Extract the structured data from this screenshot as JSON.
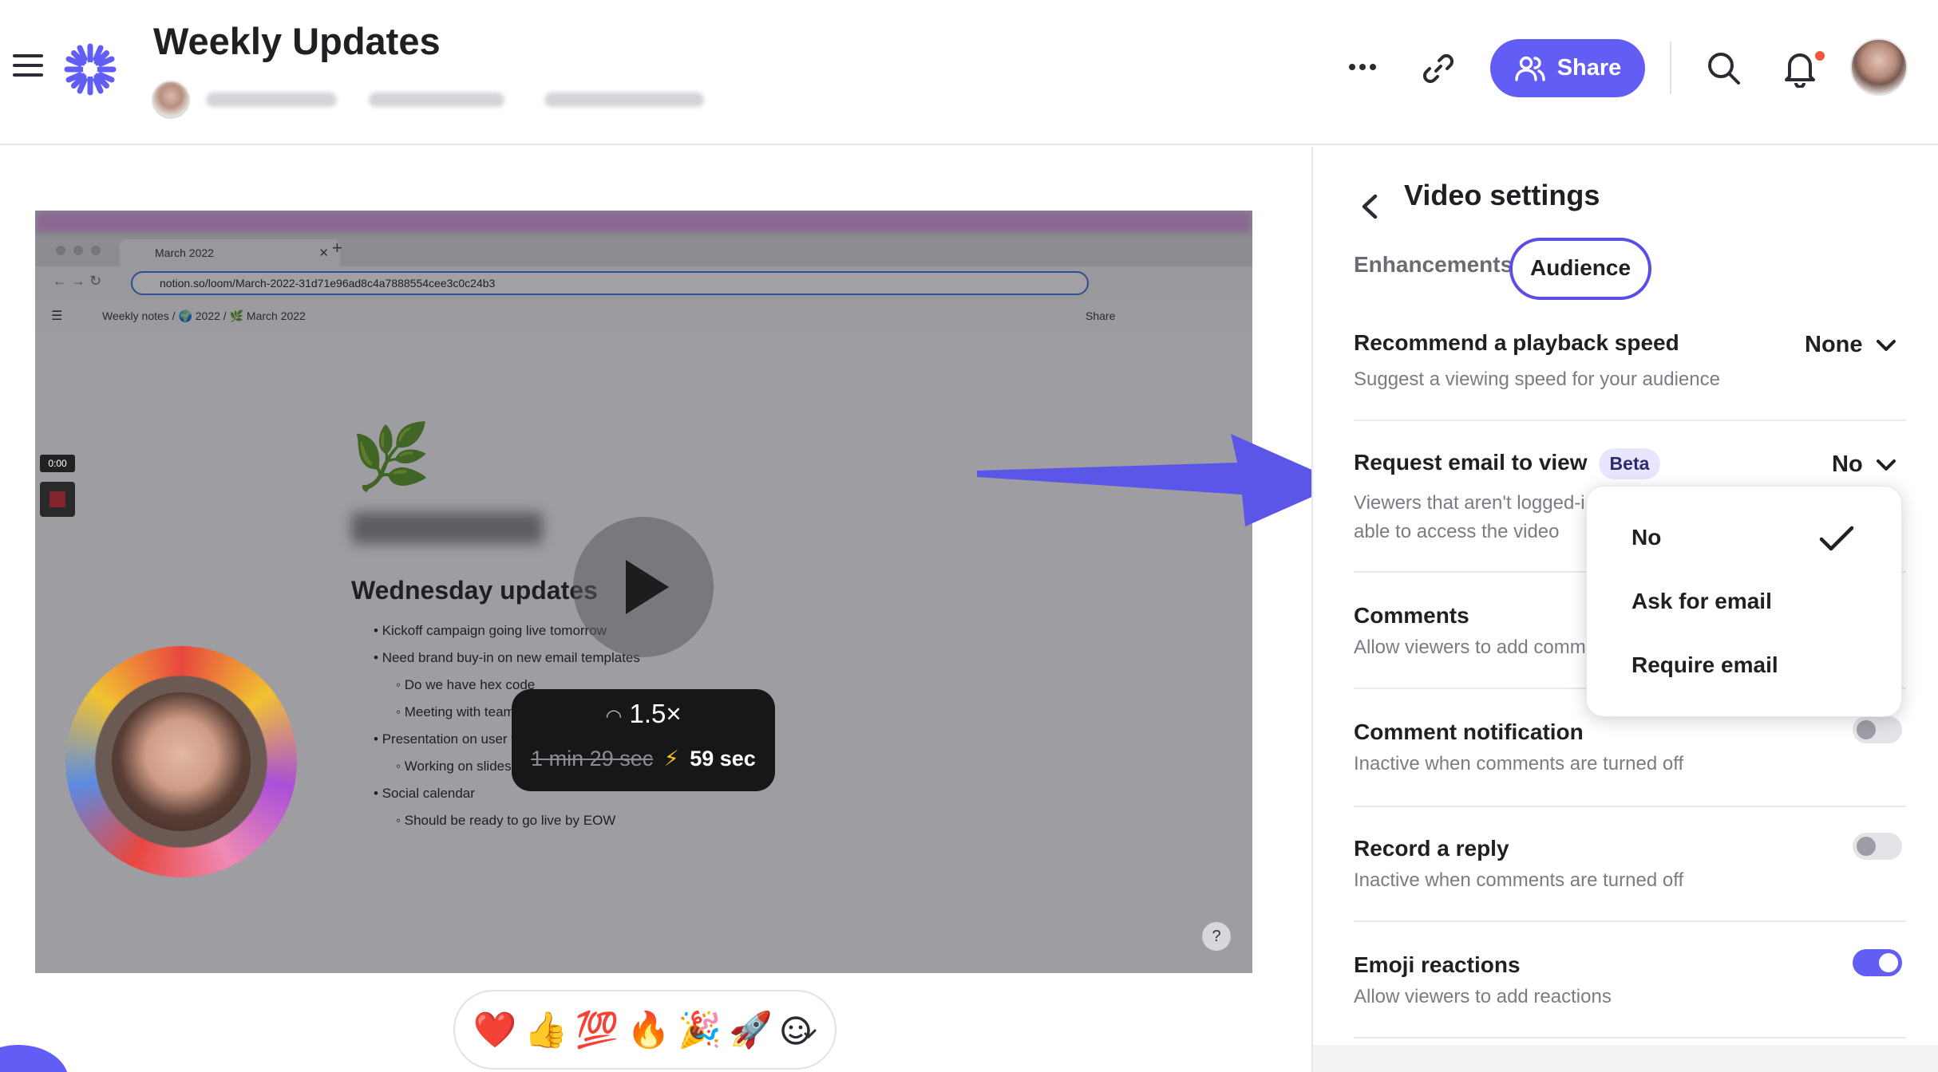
{
  "header": {
    "title": "Weekly Updates",
    "share_label": "Share"
  },
  "video": {
    "tab_title": "March 2022",
    "url": "notion.so/loom/March-2022-31d71e96ad8c4a7888554cee3c0c24b3",
    "breadcrumb": "Weekly notes  /  🌍 2022  /  🌿 March 2022",
    "notion_share": "Share",
    "timestamp": "0:00",
    "section_heading": "Wednesday updates",
    "bullets": [
      {
        "level": 1,
        "text": "Kickoff campaign going live tomorrow"
      },
      {
        "level": 1,
        "text": "Need brand buy-in on new email templates"
      },
      {
        "level": 2,
        "text": "Do we have hex code"
      },
      {
        "level": 2,
        "text": "Meeting with team fe"
      },
      {
        "level": 1,
        "text": "Presentation on user fe"
      },
      {
        "level": 2,
        "text": "Working on slides fo"
      },
      {
        "level": 1,
        "text": "Social calendar"
      },
      {
        "level": 2,
        "text": "Should be ready to go live by EOW"
      }
    ],
    "speed": "1.5×",
    "original_duration": "1 min 29 sec",
    "new_duration": "59 sec",
    "help": "?"
  },
  "reactions": [
    "❤️",
    "👍",
    "💯",
    "🔥",
    "🎉",
    "🚀"
  ],
  "panel": {
    "title": "Video settings",
    "tabs": {
      "enhancements": "Enhancements",
      "audience": "Audience"
    },
    "playback": {
      "title": "Recommend a playback speed",
      "desc": "Suggest a viewing speed for your audience",
      "value": "None"
    },
    "request_email": {
      "title": "Request email to view",
      "badge": "Beta",
      "desc_line1": "Viewers that aren't logged-i",
      "desc_line2": "able to access the video",
      "value": "No"
    },
    "comments": {
      "title": "Comments",
      "desc": "Allow viewers to add comm"
    },
    "comment_notification": {
      "title": "Comment notification",
      "desc": "Inactive when comments are turned off",
      "enabled": false
    },
    "record_reply": {
      "title": "Record a reply",
      "desc": "Inactive when comments are turned off",
      "enabled": false
    },
    "emoji_reactions": {
      "title": "Emoji reactions",
      "desc": "Allow viewers to add reactions",
      "enabled": true
    }
  },
  "email_menu": {
    "options": [
      "No",
      "Ask for email",
      "Require email"
    ],
    "selected": "No"
  },
  "colors": {
    "accent": "#625df5",
    "notification_dot": "#f0583b",
    "arrow": "#5b56e8"
  }
}
